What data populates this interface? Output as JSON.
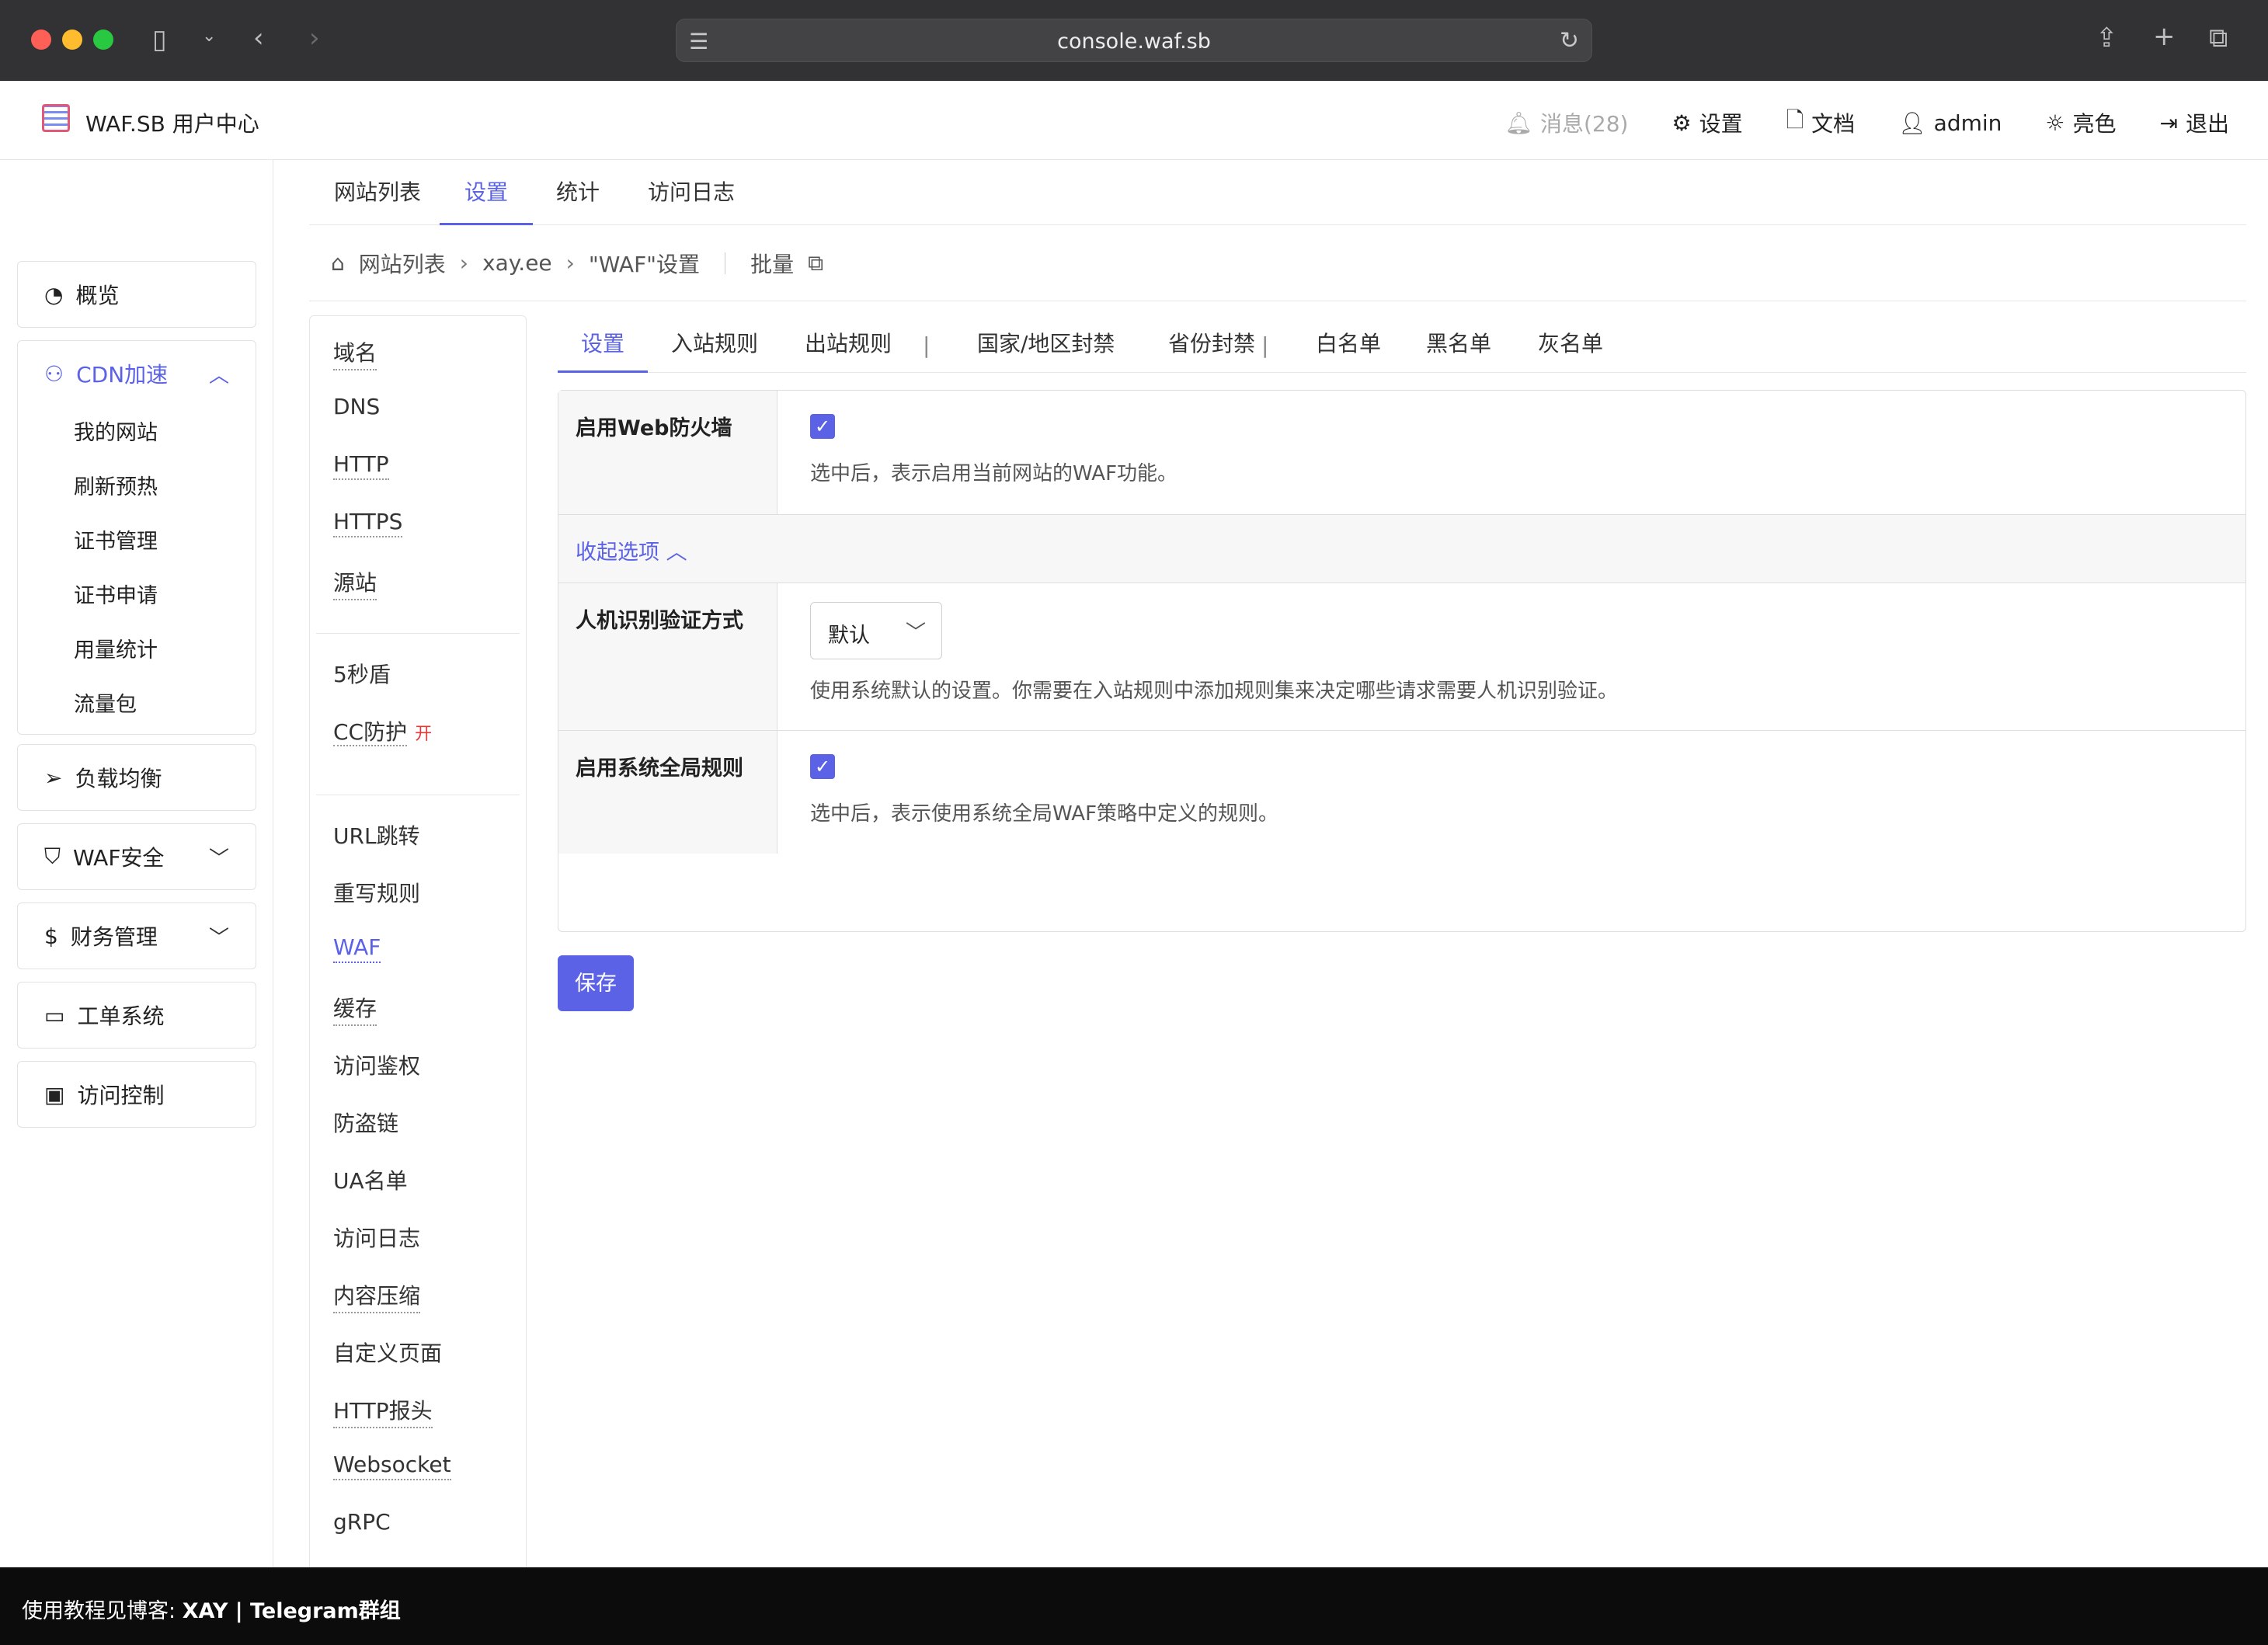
{
  "browser": {
    "url": "console.waf.sb",
    "icons": [
      "sidebar-icon",
      "chevron-down-icon",
      "back-icon",
      "forward-icon",
      "reload-icon",
      "share-icon",
      "new-tab-icon",
      "tabs-overview-icon"
    ]
  },
  "header": {
    "title": "WAF.SB 用户中心",
    "messages": "消息(28)",
    "settings": "设置",
    "docs": "文档",
    "user": "admin",
    "theme": "亮色",
    "logout": "退出"
  },
  "sidebar": {
    "overview": "概览",
    "cdn": "CDN加速",
    "cdn_items": [
      "我的网站",
      "刷新预热",
      "证书管理",
      "证书申请",
      "用量统计",
      "流量包"
    ],
    "load_balance": "负载均衡",
    "waf_security": "WAF安全",
    "finance": "财务管理",
    "tickets": "工单系统",
    "access_control": "访问控制"
  },
  "top_tabs": [
    "网站列表",
    "设置",
    "统计",
    "访问日志"
  ],
  "breadcrumb": {
    "home": "网站列表",
    "site": "xay.ee",
    "current": "\"WAF\"设置",
    "batch": "批量"
  },
  "menu": {
    "group1": [
      "域名",
      "DNS",
      "HTTP",
      "HTTPS",
      "源站"
    ],
    "group2_a": "5秒盾",
    "group2_b": "CC防护",
    "cc_badge": "开",
    "group3": [
      "URL跳转",
      "重写规则",
      "WAF",
      "缓存",
      "访问鉴权",
      "防盗链",
      "UA名单",
      "访问日志",
      "内容压缩",
      "自定义页面",
      "HTTP报头",
      "Websocket",
      "gRPC"
    ]
  },
  "sub_tabs": [
    "设置",
    "入站规则",
    "出站规则",
    "|",
    "国家/地区封禁",
    "省份封禁",
    "|",
    "白名单",
    "黑名单",
    "灰名单"
  ],
  "form": {
    "enable_waf_label": "启用Web防火墙",
    "enable_waf_checked": true,
    "enable_waf_hint": "选中后，表示启用当前网站的WAF功能。",
    "collapse": "收起选项",
    "captcha_label": "人机识别验证方式",
    "captcha_value": "默认",
    "captcha_hint": "使用系统默认的设置。你需要在入站规则中添加规则集来决定哪些请求需要人机识别验证。",
    "global_rules_label": "启用系统全局规则",
    "global_rules_checked": true,
    "global_rules_hint": "选中后，表示使用系统全局WAF策略中定义的规则。",
    "save": "保存"
  },
  "footer": {
    "prefix": "使用教程见博客: ",
    "blog": "XAY",
    "divider": " | ",
    "telegram": "Telegram群组"
  },
  "colors": {
    "accent": "#5b62e6",
    "badge_red": "#e03b3b"
  }
}
